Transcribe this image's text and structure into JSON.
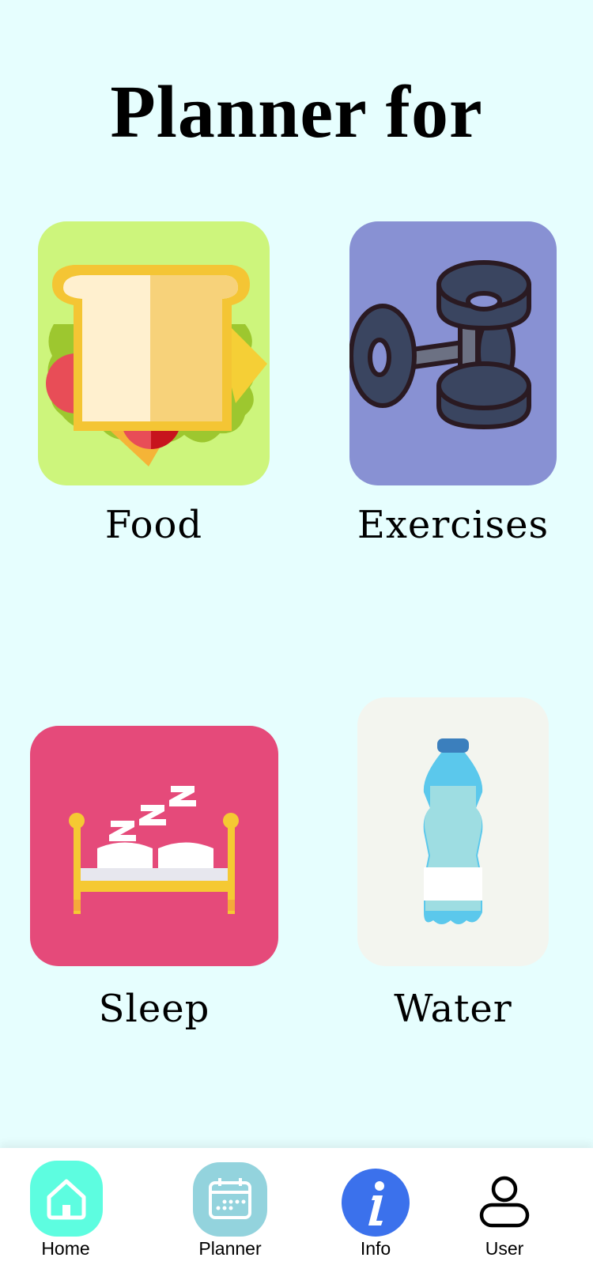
{
  "page": {
    "title": "Planner for"
  },
  "tiles": [
    {
      "label": "Food",
      "icon": "sandwich-icon",
      "bg": "#cdf57c"
    },
    {
      "label": "Exercises",
      "icon": "dumbbell-icon",
      "bg": "#8891d3"
    },
    {
      "label": "Sleep",
      "icon": "bed-icon",
      "bg": "#e54a7a"
    },
    {
      "label": "Water",
      "icon": "water-bottle-icon",
      "bg": "#f3f5ef"
    }
  ],
  "nav": {
    "items": [
      {
        "label": "Home",
        "icon": "home-icon",
        "bg": "#5dfde0"
      },
      {
        "label": "Planner",
        "icon": "calendar-icon",
        "bg": "#93d3dd"
      },
      {
        "label": "Info",
        "icon": "info-icon",
        "bg": "#3b71ec"
      },
      {
        "label": "User",
        "icon": "user-icon"
      }
    ]
  }
}
